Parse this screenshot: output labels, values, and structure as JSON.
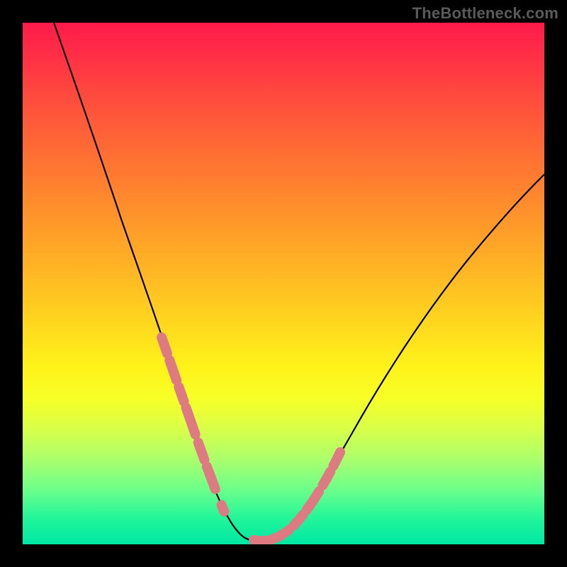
{
  "watermark": "TheBottleneck.com",
  "chart_data": {
    "type": "line",
    "title": "",
    "xlabel": "",
    "ylabel": "",
    "xlim": [
      0,
      100
    ],
    "ylim": [
      0,
      100
    ],
    "gradient_stops": [
      {
        "pos": 0,
        "color": "#ff1a4a"
      },
      {
        "pos": 14,
        "color": "#ff4a3e"
      },
      {
        "pos": 34,
        "color": "#ff8a2c"
      },
      {
        "pos": 56,
        "color": "#ffd21f"
      },
      {
        "pos": 72,
        "color": "#f7ff26"
      },
      {
        "pos": 90,
        "color": "#66ff8c"
      },
      {
        "pos": 100,
        "color": "#00e8a4"
      }
    ],
    "series": [
      {
        "name": "bottleneck-curve",
        "x": [
          6,
          9,
          12,
          15,
          18,
          21,
          24,
          27,
          30,
          32,
          34,
          36,
          38,
          40,
          42,
          44,
          47,
          50,
          54,
          58,
          62,
          66,
          70,
          75,
          80,
          85,
          90,
          95,
          100
        ],
        "y": [
          100,
          90,
          80,
          71,
          62,
          54,
          46,
          39,
          32,
          27,
          22,
          17,
          12,
          8,
          4,
          2,
          1,
          2,
          5,
          10,
          16,
          22,
          28,
          35,
          42,
          49,
          56,
          62,
          68
        ]
      }
    ],
    "highlight_segments": [
      {
        "name": "left-highlight",
        "x_range": [
          27,
          38
        ],
        "y_range": [
          39,
          12
        ]
      },
      {
        "name": "right-highlight",
        "x_range": [
          44,
          56
        ],
        "y_range": [
          2,
          8
        ]
      }
    ],
    "highlight_color": "#dd7a82",
    "curve_color": "#000000"
  }
}
